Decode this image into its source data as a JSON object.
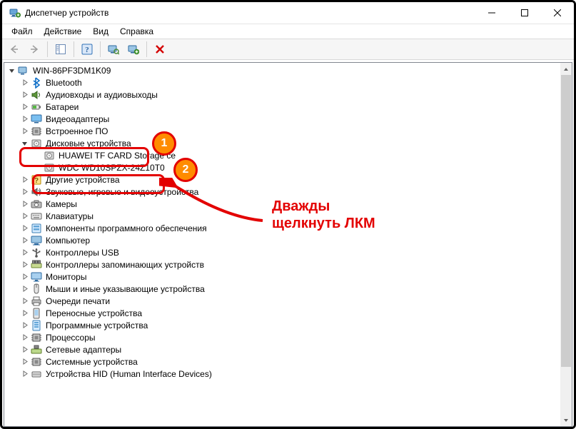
{
  "window": {
    "title": "Диспетчер устройств"
  },
  "menu": {
    "file": "Файл",
    "action": "Действие",
    "view": "Вид",
    "help": "Справка"
  },
  "tree": {
    "root": "WIN-86PF3DM1K09",
    "items": [
      {
        "label": "Bluetooth",
        "icon": "bluetooth"
      },
      {
        "label": "Аудиовходы и аудиовыходы",
        "icon": "audio"
      },
      {
        "label": "Батареи",
        "icon": "battery"
      },
      {
        "label": "Видеоадаптеры",
        "icon": "display"
      },
      {
        "label": "Встроенное ПО",
        "icon": "chip"
      },
      {
        "label": "Дисковые устройства",
        "icon": "disk",
        "expanded": true,
        "children": [
          {
            "label": "HUAWEI TF CARD Storage            ce",
            "icon": "disk"
          },
          {
            "label": "WDC WD10SPZX-24Z10T0",
            "icon": "disk"
          }
        ]
      },
      {
        "label": "Другие устройства",
        "icon": "other"
      },
      {
        "label": "Звуковые, игровые и видеоустройства",
        "icon": "sound"
      },
      {
        "label": "Камеры",
        "icon": "camera"
      },
      {
        "label": "Клавиатуры",
        "icon": "keyboard"
      },
      {
        "label": "Компоненты программного обеспечения",
        "icon": "software"
      },
      {
        "label": "Компьютер",
        "icon": "computer"
      },
      {
        "label": "Контроллеры USB",
        "icon": "usb"
      },
      {
        "label": "Контроллеры запоминающих устройств",
        "icon": "storagectrl"
      },
      {
        "label": "Мониторы",
        "icon": "monitor"
      },
      {
        "label": "Мыши и иные указывающие устройства",
        "icon": "mouse"
      },
      {
        "label": "Очереди печати",
        "icon": "printer"
      },
      {
        "label": "Переносные устройства",
        "icon": "portable"
      },
      {
        "label": "Программные устройства",
        "icon": "software2"
      },
      {
        "label": "Процессоры",
        "icon": "chip"
      },
      {
        "label": "Сетевые адаптеры",
        "icon": "network"
      },
      {
        "label": "Системные устройства",
        "icon": "chip"
      },
      {
        "label": "Устройства HID (Human Interface Devices)",
        "icon": "hid"
      }
    ]
  },
  "annotation": {
    "marker1": "1",
    "marker2": "2",
    "text_line1": "Дважды",
    "text_line2": "щелкнуть ЛКМ"
  }
}
